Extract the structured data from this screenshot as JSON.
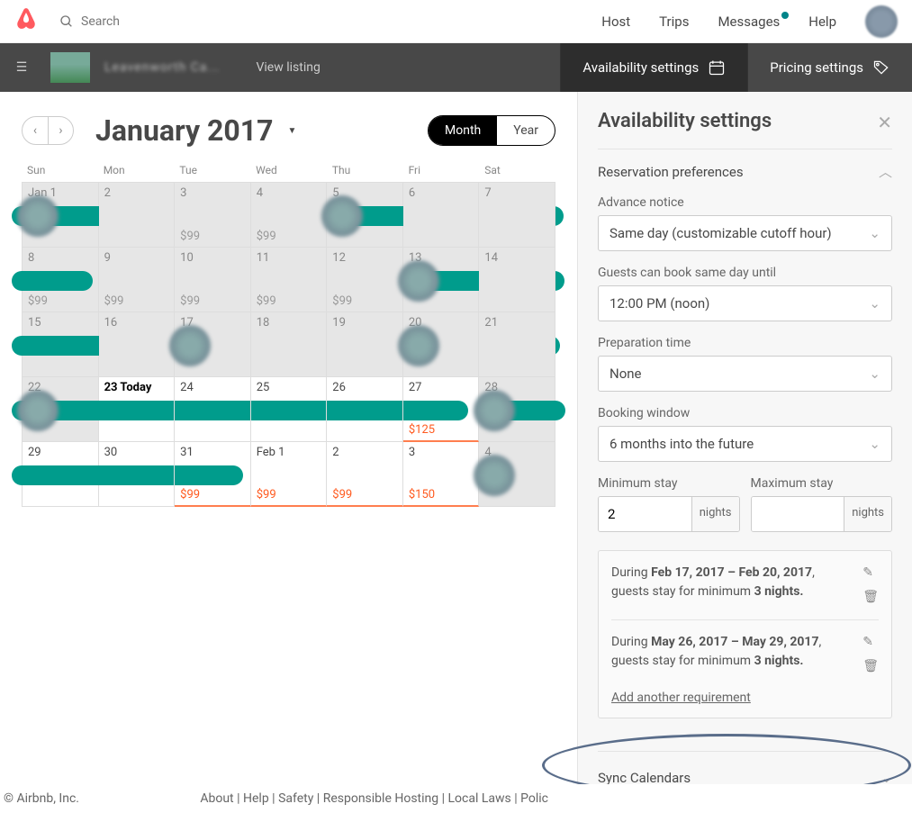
{
  "top": {
    "search_placeholder": "Search",
    "nav": [
      "Host",
      "Trips",
      "Messages",
      "Help"
    ]
  },
  "sub": {
    "listing": "Leavenworth Ca...",
    "view": "View listing",
    "avail": "Availability settings",
    "pricing": "Pricing settings"
  },
  "cal": {
    "title": "January 2017",
    "month": "Month",
    "year": "Year",
    "dow": [
      "Sun",
      "Mon",
      "Tue",
      "Wed",
      "Thu",
      "Fri",
      "Sat"
    ],
    "cells": [
      {
        "n": "Jan 1",
        "past": true
      },
      {
        "n": "2",
        "past": true
      },
      {
        "n": "3",
        "past": true,
        "p": "$99"
      },
      {
        "n": "4",
        "past": true,
        "p": "$99"
      },
      {
        "n": "5",
        "past": true
      },
      {
        "n": "6",
        "past": true
      },
      {
        "n": "7",
        "past": true
      },
      {
        "n": "8",
        "past": true,
        "p": "$99"
      },
      {
        "n": "9",
        "past": true,
        "p": "$99"
      },
      {
        "n": "10",
        "past": true,
        "p": "$99"
      },
      {
        "n": "11",
        "past": true,
        "p": "$99"
      },
      {
        "n": "12",
        "past": true,
        "p": "$99"
      },
      {
        "n": "13",
        "past": true
      },
      {
        "n": "14",
        "past": true
      },
      {
        "n": "15",
        "past": true
      },
      {
        "n": "16",
        "past": true
      },
      {
        "n": "17",
        "past": true
      },
      {
        "n": "18",
        "past": true
      },
      {
        "n": "19",
        "past": true
      },
      {
        "n": "20",
        "past": true
      },
      {
        "n": "21",
        "past": true
      },
      {
        "n": "22",
        "past": true
      },
      {
        "n": "23 Today",
        "today": true
      },
      {
        "n": "24"
      },
      {
        "n": "25"
      },
      {
        "n": "26"
      },
      {
        "n": "27",
        "p": "$125",
        "red": true
      },
      {
        "n": "28",
        "past": true
      },
      {
        "n": "29"
      },
      {
        "n": "30"
      },
      {
        "n": "31",
        "p": "$99",
        "red": true
      },
      {
        "n": "Feb 1",
        "p": "$99",
        "red": true
      },
      {
        "n": "2",
        "p": "$99",
        "red": true
      },
      {
        "n": "3",
        "p": "$150",
        "red": true
      },
      {
        "n": "4",
        "past": true
      }
    ]
  },
  "sp": {
    "title": "Availability settings",
    "res_pref": "Reservation preferences",
    "advance": "Advance notice",
    "advance_v": "Same day (customizable cutoff hour)",
    "sameday": "Guests can book same day until",
    "sameday_v": "12:00 PM (noon)",
    "prep": "Preparation time",
    "prep_v": "None",
    "window": "Booking window",
    "window_v": "6 months into the future",
    "min": "Minimum stay",
    "min_v": "2",
    "max": "Maximum stay",
    "max_v": "",
    "nights": "nights",
    "req1a": "During ",
    "req1b": "Feb 17, 2017 – Feb 20, 2017",
    "req1c": ", guests stay for minimum ",
    "req1d": "3 nights.",
    "req2a": "During ",
    "req2b": "May 26, 2017 – May 29, 2017",
    "req2c": ", guests stay for minimum ",
    "req2d": "3 nights.",
    "add": "Add another requirement",
    "sync": "Sync Calendars"
  },
  "footer": {
    "copy": "© Airbnb, Inc.",
    "links": [
      "About",
      "Help",
      "Safety",
      "Responsible Hosting",
      "Local Laws",
      "Polic"
    ]
  }
}
